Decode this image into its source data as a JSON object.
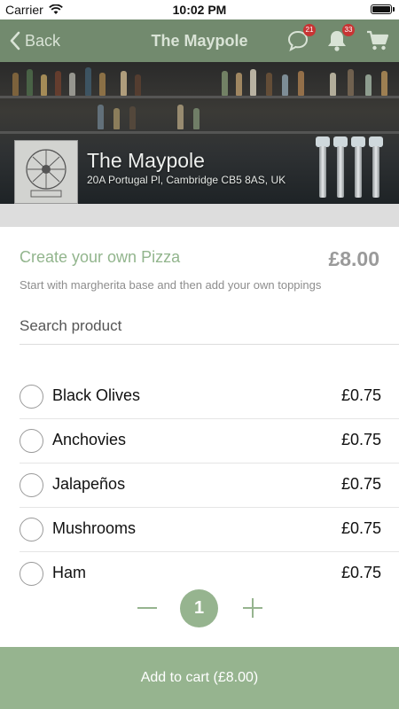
{
  "status_bar": {
    "carrier": "Carrier",
    "time": "10:02 PM"
  },
  "nav": {
    "back_label": "Back",
    "title": "The Maypole",
    "chat_badge": "21",
    "notification_badge": "33",
    "icons": [
      "chevron-left-icon",
      "chat-icon",
      "bell-icon",
      "cart-icon"
    ]
  },
  "venue": {
    "name": "The Maypole",
    "address": "20A Portugal Pl, Cambridge CB5 8AS, UK"
  },
  "product": {
    "title": "Create your own Pizza",
    "price": "£8.00",
    "description": "Start with margherita base and then add your own toppings"
  },
  "search": {
    "placeholder": "Search product",
    "value": ""
  },
  "toppings": [
    {
      "name": "Black Olives",
      "price": "£0.75",
      "selected": false
    },
    {
      "name": "Anchovies",
      "price": "£0.75",
      "selected": false
    },
    {
      "name": "Jalapeños",
      "price": "£0.75",
      "selected": false
    },
    {
      "name": "Mushrooms",
      "price": "£0.75",
      "selected": false
    },
    {
      "name": "Ham",
      "price": "£0.75",
      "selected": false
    }
  ],
  "quantity": {
    "value": "1"
  },
  "cart_button": {
    "label": "Add to cart (£8.00)"
  },
  "colors": {
    "nav": "#728a6e",
    "accent": "#96b48f",
    "badge": "#c83434"
  }
}
